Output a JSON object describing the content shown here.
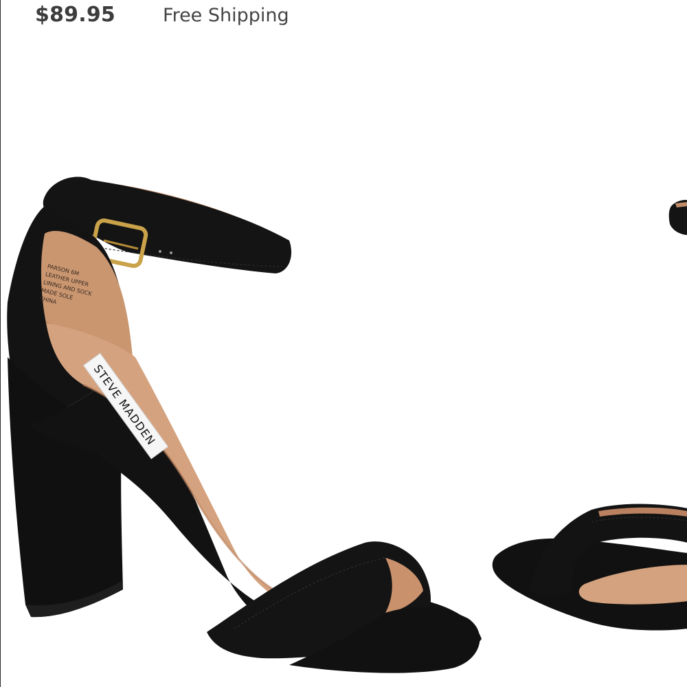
{
  "listing": {
    "price": "$89.95",
    "shipping": "Free Shipping"
  },
  "product": {
    "brand_label": "STEVE MADDEN",
    "insole_print": [
      "PARSON 6M",
      "LEATHER UPPER",
      "LINING AND SOCK",
      "MADE SOLE",
      "CHINA"
    ],
    "colors": {
      "suede": "#111111",
      "insole": "#d4a27e",
      "insole_shadow": "#b77f5c",
      "buckle": "#c9a24a",
      "tag": "#f6f6f6"
    }
  }
}
